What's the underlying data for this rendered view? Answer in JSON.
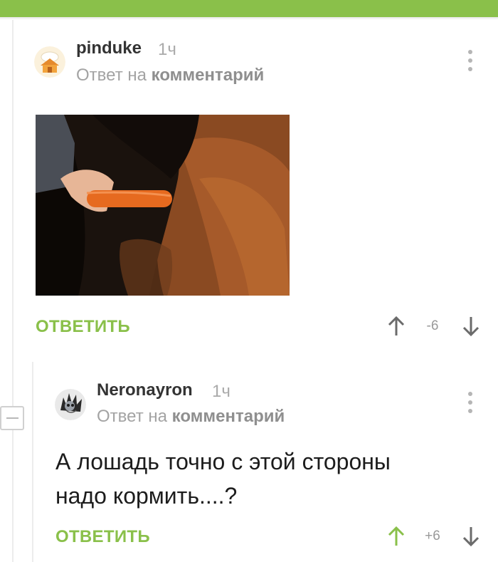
{
  "comments": [
    {
      "username": "pinduke",
      "time": "1ч",
      "reply_prefix": "Ответ на",
      "reply_target": "комментарий",
      "avatar_icon": "chef-house-avatar",
      "reply_label": "ОТВЕТИТЬ",
      "rating": "-6"
    },
    {
      "username": "Neronayron",
      "time": "1ч",
      "reply_prefix": "Ответ на",
      "reply_target": "комментарий",
      "avatar_icon": "spiky-creature-avatar",
      "text_line1": "А лошадь точно с этой стороны",
      "text_line2": "надо кормить....?",
      "reply_label": "ОТВЕТИТЬ",
      "rating": "+6",
      "upvoted": true
    }
  ],
  "colors": {
    "accent": "#8ac04a",
    "muted": "#a3a3a3"
  }
}
